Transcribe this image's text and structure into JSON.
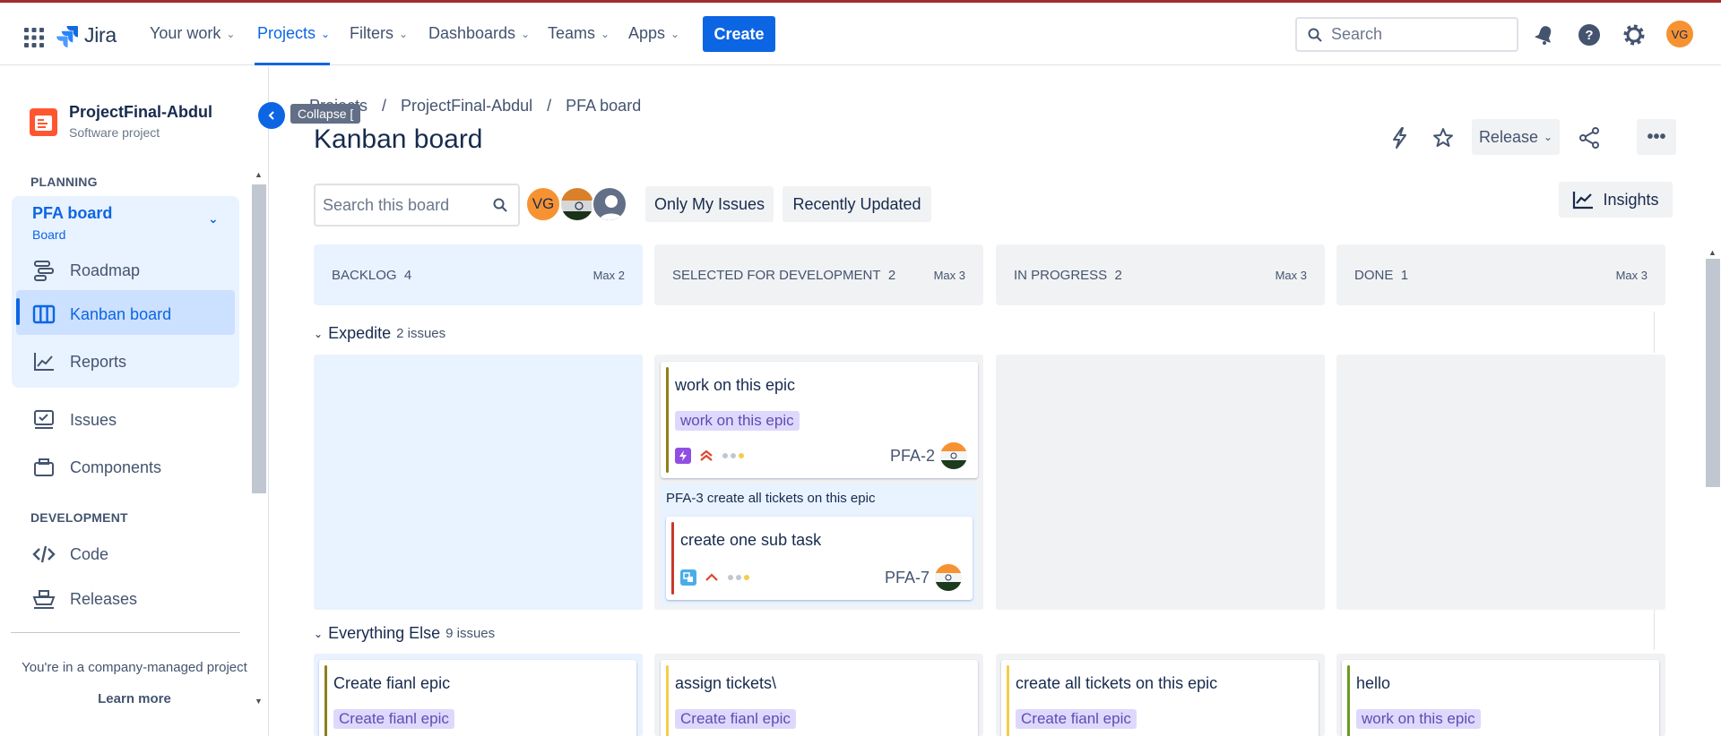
{
  "topnav": {
    "brand": "Jira",
    "items": [
      {
        "label": "Your work"
      },
      {
        "label": "Projects"
      },
      {
        "label": "Filters"
      },
      {
        "label": "Dashboards"
      },
      {
        "label": "Teams"
      },
      {
        "label": "Apps"
      }
    ],
    "create_label": "Create",
    "search_placeholder": "Search",
    "user_initials": "VG"
  },
  "sidebar": {
    "project_name": "ProjectFinal-Abdul",
    "project_type": "Software project",
    "planning_heading": "PLANNING",
    "board_name": "PFA board",
    "board_sub": "Board",
    "planning_items": [
      {
        "label": "Roadmap"
      },
      {
        "label": "Kanban board"
      },
      {
        "label": "Reports"
      }
    ],
    "other_items": [
      {
        "label": "Issues"
      },
      {
        "label": "Components"
      }
    ],
    "development_heading": "DEVELOPMENT",
    "dev_items": [
      {
        "label": "Code"
      },
      {
        "label": "Releases"
      }
    ],
    "company_note": "You're in a company-managed project",
    "learn_more": "Learn more",
    "collapse_tooltip": "Collapse ["
  },
  "breadcrumb": [
    "Projects",
    "/",
    "ProjectFinal-Abdul",
    "/",
    "PFA board"
  ],
  "page_title": "Kanban board",
  "header_actions": {
    "release_label": "Release",
    "more_label": "•••"
  },
  "toolbar": {
    "search_placeholder": "Search this board",
    "user_initials": "VG",
    "only_my_issues": "Only My Issues",
    "recently_updated": "Recently Updated",
    "insights": "Insights"
  },
  "columns": [
    {
      "name": "BACKLOG",
      "count": "4",
      "max": "Max 2"
    },
    {
      "name": "SELECTED FOR DEVELOPMENT",
      "count": "2",
      "max": "Max 3"
    },
    {
      "name": "IN PROGRESS",
      "count": "2",
      "max": "Max 3"
    },
    {
      "name": "DONE",
      "count": "1",
      "max": "Max 3"
    }
  ],
  "swimlanes": [
    {
      "name": "Expedite",
      "count": "2 issues"
    },
    {
      "name": "Everything Else",
      "count": "9 issues"
    }
  ],
  "cards": {
    "pfa2": {
      "title": "work on this epic",
      "epic": "work on this epic",
      "key": "PFA-2"
    },
    "parent_label": "PFA-3  create all tickets on this epic",
    "pfa7": {
      "title": "create one sub task",
      "key": "PFA-7"
    },
    "e1": {
      "title": "Create fianl epic",
      "epic": "Create fianl epic"
    },
    "e2": {
      "title": "assign tickets\\",
      "epic": "Create fianl epic"
    },
    "e3": {
      "title": "create all tickets on this epic",
      "epic": "Create fianl epic"
    },
    "e4": {
      "title": "hello",
      "epic": "work on this epic"
    }
  },
  "colors": {
    "brand_blue": "#0c66e4",
    "epic_bg": "#dfd8fd",
    "epic_text": "#5e4db2",
    "olive_stripe": "#8f7f1c",
    "yellow_stripe": "#f5cd47",
    "pink_stripe": "#c9372c",
    "green_stripe": "#6a9a23"
  }
}
